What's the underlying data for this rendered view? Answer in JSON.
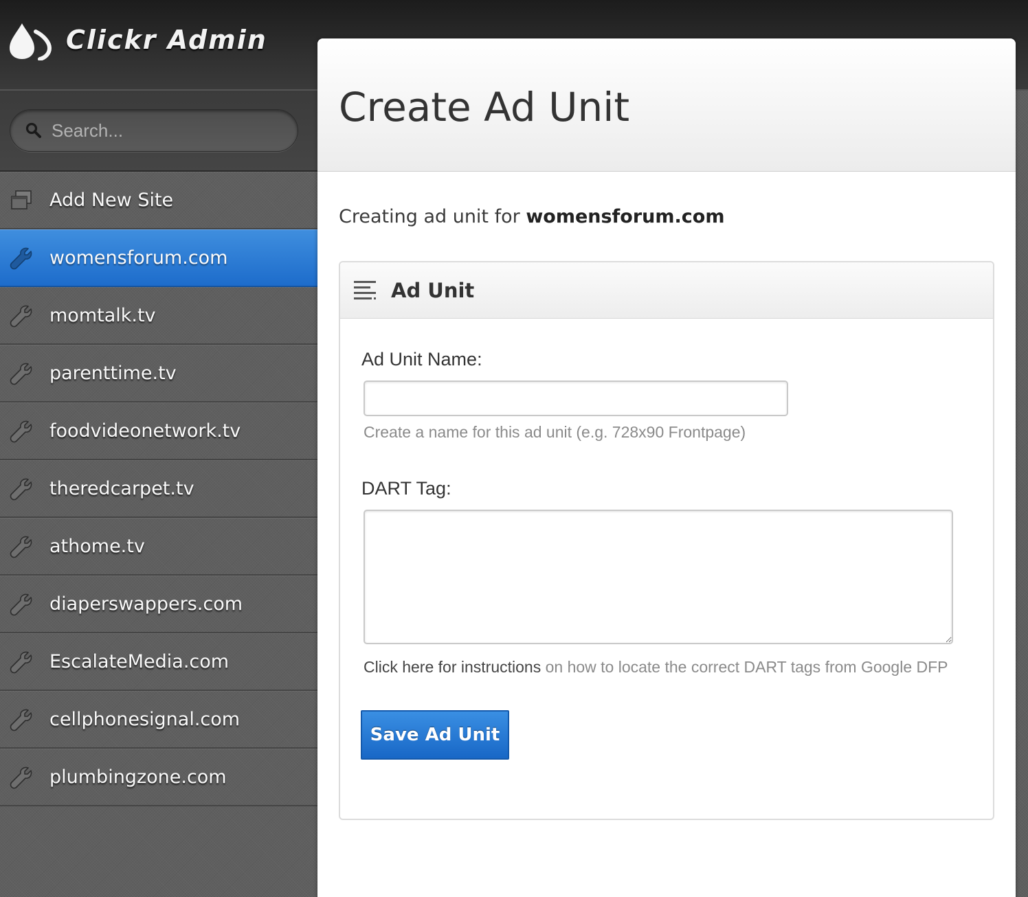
{
  "app": {
    "name": "Clickr Admin",
    "logo_icon": "clickr-drop-logo"
  },
  "search": {
    "placeholder": "Search...",
    "icon": "search-icon"
  },
  "sidebar": {
    "items": [
      {
        "label": "Add New Site",
        "icon": "windows-stack-icon",
        "active": false
      },
      {
        "label": "womensforum.com",
        "icon": "wrench-icon",
        "active": true
      },
      {
        "label": "momtalk.tv",
        "icon": "wrench-icon",
        "active": false
      },
      {
        "label": "parenttime.tv",
        "icon": "wrench-icon",
        "active": false
      },
      {
        "label": "foodvideonetwork.tv",
        "icon": "wrench-icon",
        "active": false
      },
      {
        "label": "theredcarpet.tv",
        "icon": "wrench-icon",
        "active": false
      },
      {
        "label": "athome.tv",
        "icon": "wrench-icon",
        "active": false
      },
      {
        "label": "diaperswappers.com",
        "icon": "wrench-icon",
        "active": false
      },
      {
        "label": "EscalateMedia.com",
        "icon": "wrench-icon",
        "active": false
      },
      {
        "label": "cellphonesignal.com",
        "icon": "wrench-icon",
        "active": false
      },
      {
        "label": "plumbingzone.com",
        "icon": "wrench-icon",
        "active": false
      }
    ]
  },
  "main": {
    "title": "Create Ad Unit",
    "creating_prefix": "Creating ad unit for",
    "site_name": "womensforum.com",
    "box": {
      "title": "Ad Unit",
      "icon": "lines-icon"
    },
    "form": {
      "name_label": "Ad Unit Name:",
      "name_value": "",
      "name_help": "Create a name for this ad unit (e.g. 728x90 Frontpage)",
      "dart_label": "DART Tag:",
      "dart_value": "",
      "dart_help_link": "Click here for instructions",
      "dart_help_rest": " on how to locate the correct DART tags from Google DFP",
      "save_label": "Save Ad Unit"
    }
  },
  "colors": {
    "accent": "#1d6ccb",
    "header": "#2a2a2a",
    "sidebar": "#5f5f5f"
  }
}
